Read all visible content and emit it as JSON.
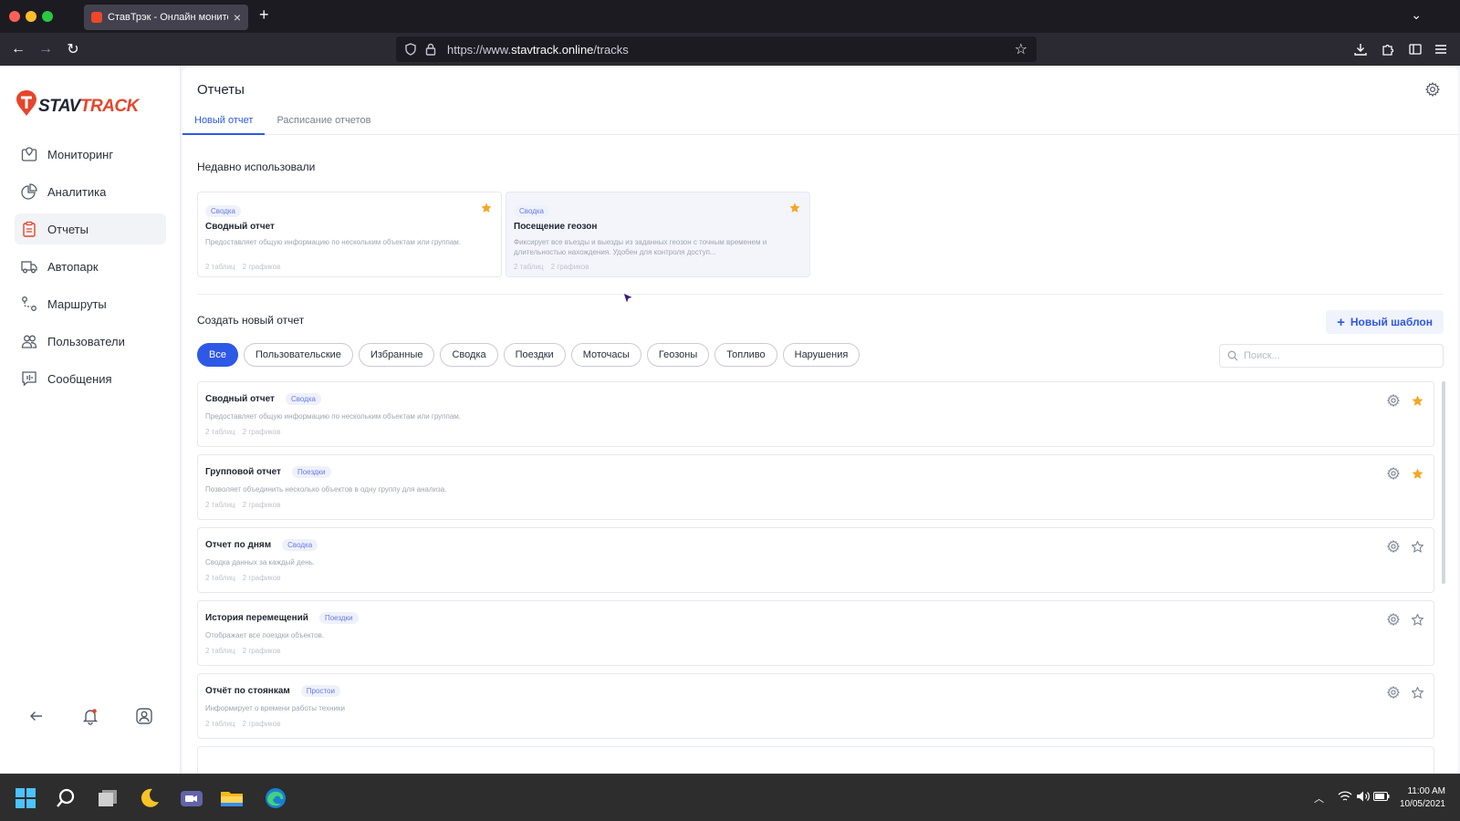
{
  "browser": {
    "tab_title": "СтавТрэк - Онлайн мониторинг",
    "url_prefix": "https://www.",
    "url_domain": "stavtrack.online",
    "url_path": "/tracks"
  },
  "logo": {
    "text_a": "STAV",
    "text_b": "TRACK"
  },
  "sidebar": {
    "items": [
      {
        "label": "Мониторинг",
        "icon": "map-pin-icon",
        "active": false
      },
      {
        "label": "Аналитика",
        "icon": "pie-chart-icon",
        "active": false
      },
      {
        "label": "Отчеты",
        "icon": "clipboard-icon",
        "active": true
      },
      {
        "label": "Автопарк",
        "icon": "truck-icon",
        "active": false
      },
      {
        "label": "Маршруты",
        "icon": "route-icon",
        "active": false
      },
      {
        "label": "Пользователи",
        "icon": "users-icon",
        "active": false
      },
      {
        "label": "Сообщения",
        "icon": "message-icon",
        "active": false
      }
    ]
  },
  "header": {
    "title": "Отчеты"
  },
  "tabs": [
    {
      "label": "Новый отчет",
      "active": true
    },
    {
      "label": "Расписание отчетов",
      "active": false
    }
  ],
  "recent": {
    "title": "Недавно использовали",
    "cards": [
      {
        "badge": "Сводка",
        "title": "Сводный отчет",
        "desc": "Предоставляет общую информацию по нескольким объектам или группам.",
        "tables": "2 таблиц",
        "charts": "2 графиков",
        "starred": true
      },
      {
        "badge": "Сводка",
        "title": "Посещение геозон",
        "desc": "Фиксирует все въезды и выезды из заданных геозон с точным временем и длительностью нахождения. Удобен для контроля доступ...",
        "tables": "2 таблиц",
        "charts": "2 графиков",
        "starred": true
      }
    ]
  },
  "create": {
    "title": "Создать новый отчет",
    "new_template": "Новый шаблон",
    "search_placeholder": "Поиск...",
    "filters": [
      {
        "label": "Все",
        "active": true
      },
      {
        "label": "Пользовательские",
        "active": false
      },
      {
        "label": "Избранные",
        "active": false
      },
      {
        "label": "Сводка",
        "active": false
      },
      {
        "label": "Поездки",
        "active": false
      },
      {
        "label": "Моточасы",
        "active": false
      },
      {
        "label": "Геозоны",
        "active": false
      },
      {
        "label": "Топливо",
        "active": false
      },
      {
        "label": "Нарушения",
        "active": false
      }
    ],
    "reports": [
      {
        "title": "Сводный отчет",
        "badge": "Сводка",
        "desc": "Предоставляет общую информацию по нескольким объектам или группам.",
        "tables": "2 таблиц",
        "charts": "2 графиков",
        "starred": true
      },
      {
        "title": "Групповой отчет",
        "badge": "Поездки",
        "desc": "Позволяет объединить несколько объектов в одну группу для анализа.",
        "tables": "2 таблиц",
        "charts": "2 графиков",
        "starred": true
      },
      {
        "title": "Отчет по дням",
        "badge": "Сводка",
        "desc": "Сводка данных за каждый день.",
        "tables": "2 таблиц",
        "charts": "2 графиков",
        "starred": false
      },
      {
        "title": "История перемещений",
        "badge": "Поездки",
        "desc": "Отображает все поездки объектов.",
        "tables": "2 таблиц",
        "charts": "2 графиков",
        "starred": false
      },
      {
        "title": "Отчёт по стоянкам",
        "badge": "Простои",
        "desc": "Информирует о времени работы техники",
        "tables": "2 таблиц",
        "charts": "2 графиков",
        "starred": false
      }
    ]
  },
  "taskbar": {
    "time": "11:00 AM",
    "date": "10/05/2021"
  },
  "colors": {
    "accent": "#2e58e6",
    "brand": "#e5452b",
    "star": "#f5a623"
  }
}
